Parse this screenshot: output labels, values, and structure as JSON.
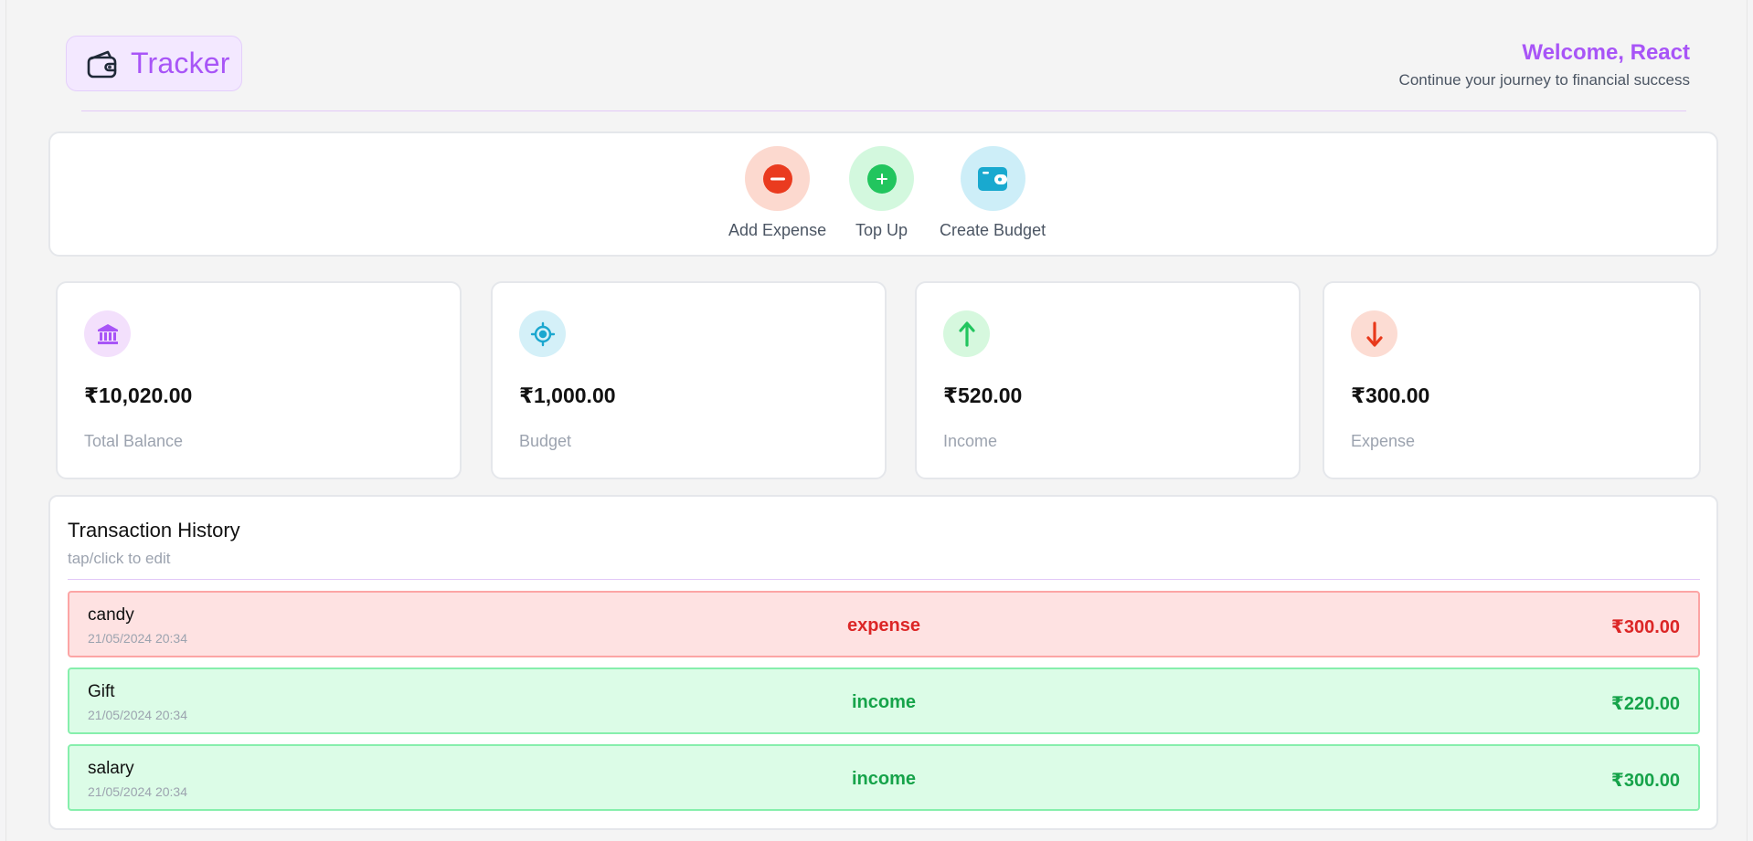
{
  "header": {
    "app_name": "Tracker",
    "welcome_title": "Welcome, React",
    "welcome_subtitle": "Continue your journey to financial success"
  },
  "actions": [
    {
      "label": "Add Expense",
      "icon": "minus-circle-icon",
      "bg": "#fcd9cf",
      "fg": "#ea3b1f"
    },
    {
      "label": "Top Up",
      "icon": "plus-circle-icon",
      "bg": "#d3f8de",
      "fg": "#22c55e"
    },
    {
      "label": "Create Budget",
      "icon": "wallet-icon",
      "bg": "#cdeef8",
      "fg": "#19a9cf"
    }
  ],
  "stats": [
    {
      "value": "₹10,020.00",
      "label": "Total Balance",
      "icon": "bank-icon",
      "bg": "#f3e0fc",
      "fg": "#a855f7"
    },
    {
      "value": "₹1,000.00",
      "label": "Budget",
      "icon": "target-icon",
      "bg": "#d4f0f8",
      "fg": "#1ba7cf"
    },
    {
      "value": "₹520.00",
      "label": "Income",
      "icon": "arrow-up-icon",
      "bg": "#d6f8de",
      "fg": "#22c55e"
    },
    {
      "value": "₹300.00",
      "label": "Expense",
      "icon": "arrow-down-icon",
      "bg": "#fcdcd3",
      "fg": "#e8391b"
    }
  ],
  "history": {
    "title": "Transaction History",
    "subtitle": "tap/click to edit",
    "items": [
      {
        "name": "candy",
        "date": "21/05/2024 20:34",
        "type": "expense",
        "amount": "₹300.00"
      },
      {
        "name": "Gift",
        "date": "21/05/2024 20:34",
        "type": "income",
        "amount": "₹220.00"
      },
      {
        "name": "salary",
        "date": "21/05/2024 20:34",
        "type": "income",
        "amount": "₹300.00"
      }
    ]
  },
  "colors": {
    "accent": "#a855f7",
    "expense": "#dc2626",
    "income": "#16a34a"
  }
}
